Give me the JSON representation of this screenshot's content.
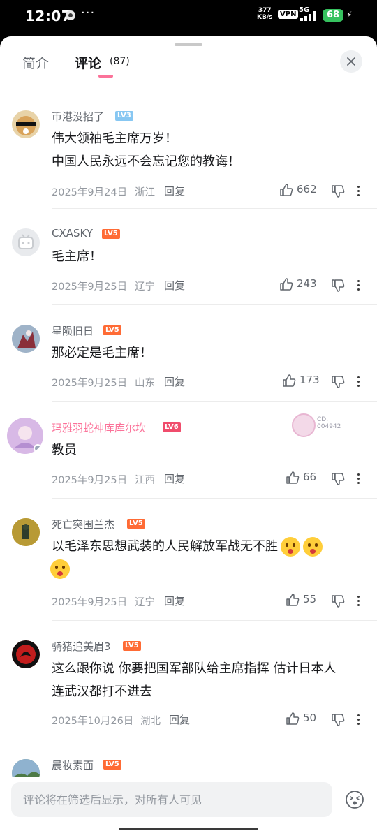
{
  "status_bar": {
    "time": "12:07",
    "dots": "···",
    "net_speed_value": "377",
    "net_speed_unit": "KB/s",
    "vpn": "VPN",
    "network": "5G",
    "battery": "68"
  },
  "tabs": {
    "intro": "简介",
    "comments": "评论",
    "comment_count": "(87)"
  },
  "comments": [
    {
      "name": "币港没招了",
      "level": "LV3",
      "lines": [
        "伟大领袖毛主席万岁！",
        "中国人民永远不会忘记您的教诲！"
      ],
      "date": "2025年9月24日",
      "region": "浙江",
      "reply": "回复",
      "likes": "662"
    },
    {
      "name": "CXASKY",
      "level": "LV5",
      "lines": [
        "毛主席！"
      ],
      "date": "2025年9月25日",
      "region": "辽宁",
      "reply": "回复",
      "likes": "243"
    },
    {
      "name": "星陨旧日",
      "level": "LV5",
      "lines": [
        "那必定是毛主席！"
      ],
      "date": "2025年9月25日",
      "region": "山东",
      "reply": "回复",
      "likes": "173"
    },
    {
      "name": "玛雅羽蛇神库库尔坎",
      "level": "LV6",
      "lines": [
        "教员"
      ],
      "date": "2025年9月25日",
      "region": "江西",
      "reply": "回复",
      "likes": "66",
      "badge_text": "CD.\n004942"
    },
    {
      "name": "死亡突围兰杰",
      "level": "LV5",
      "lines": [
        "以毛泽东思想武装的人民解放军战无不胜"
      ],
      "date": "2025年9月25日",
      "region": "辽宁",
      "reply": "回复",
      "likes": "55"
    },
    {
      "name": "骑猪追美眉3",
      "level": "LV5",
      "lines": [
        "这么跟你说 你要把国军部队给主席指挥  估计日本人",
        "连武汉都打不进去"
      ],
      "date": "2025年10月26日",
      "region": "湖北",
      "reply": "回复",
      "likes": "50"
    },
    {
      "name": "晨妆素面",
      "level": "LV5"
    }
  ],
  "input": {
    "placeholder": "评论将在筛选后显示，对所有人可见"
  },
  "colors": {
    "accent": "#fb7299",
    "text_primary": "#18191c",
    "text_secondary": "#9499a0",
    "level_orange": "#ff6b35",
    "level_blue": "#87c7f2"
  },
  "icons": [
    "close-icon",
    "thumbs-up-icon",
    "thumbs-down-icon",
    "more-icon",
    "emoji-icon"
  ]
}
